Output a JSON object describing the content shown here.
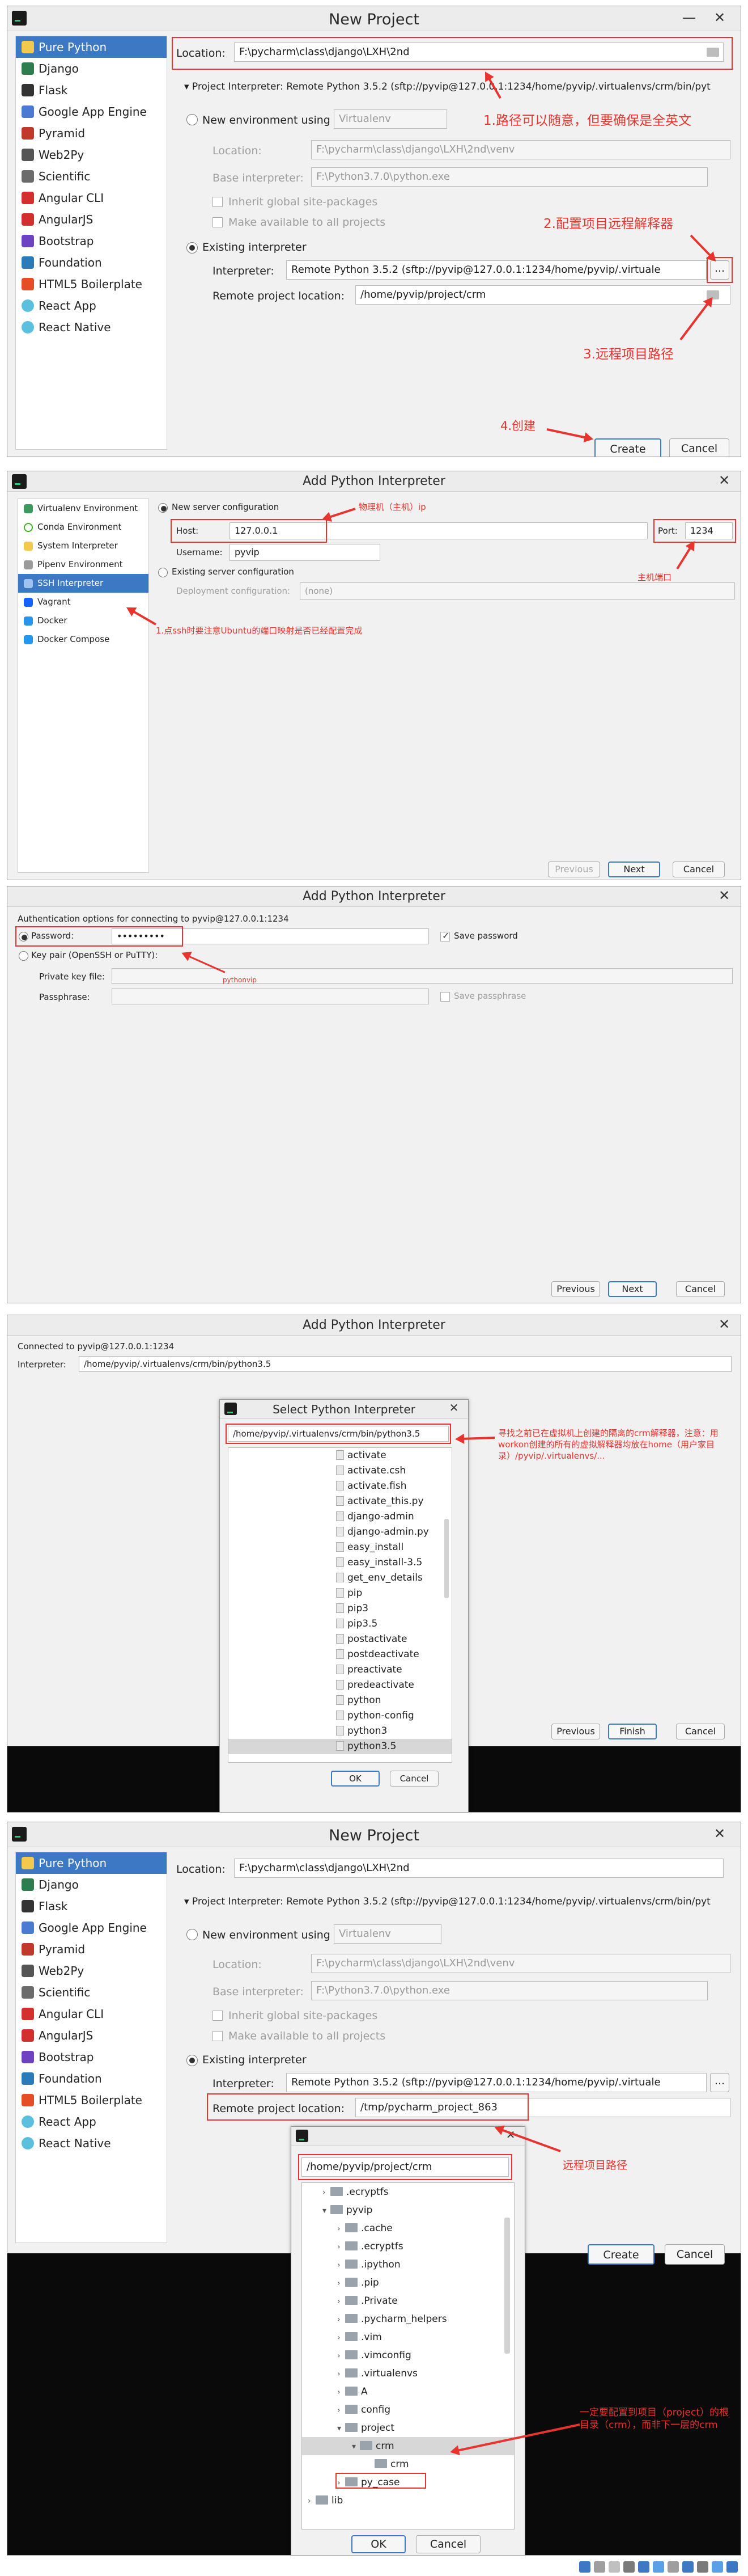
{
  "sidebar": [
    "Pure Python",
    "Django",
    "Flask",
    "Google App Engine",
    "Pyramid",
    "Web2Py",
    "Scientific",
    "Angular CLI",
    "AngularJS",
    "Bootstrap",
    "Foundation",
    "HTML5 Boilerplate",
    "React App",
    "React Native"
  ],
  "p1": {
    "title": "New Project",
    "location_label": "Location:",
    "location_value": "F:\\pycharm\\class\\django\\LXH\\2nd",
    "interp_header": "▾  Project Interpreter: Remote Python 3.5.2 (sftp://pyvip@127.0.0.1:1234/home/pyvip/.virtualenvs/crm/bin/pyt",
    "new_env": "New environment using",
    "virtualenv": "Virtualenv",
    "venv_location_label": "Location:",
    "venv_location": "F:\\pycharm\\class\\django\\LXH\\2nd\\venv",
    "base_interp_label": "Base interpreter:",
    "base_interp": "F:\\Python3.7.0\\python.exe",
    "inherit": "Inherit global site-packages",
    "make_available": "Make available to all projects",
    "existing": "Existing interpreter",
    "interp_label": "Interpreter:",
    "interp_value": "Remote Python 3.5.2 (sftp://pyvip@127.0.0.1:1234/home/pyvip/.virtuale",
    "more": "...",
    "remote_label": "Remote project location:",
    "remote_value": "/home/pyvip/project/crm",
    "note1": "1.路径可以随意，但要确保是全英文",
    "note2": "2.配置项目远程解释器",
    "note3": "3.远程项目路径",
    "note4": "4.创建",
    "create": "Create",
    "cancel": "Cancel"
  },
  "p2": {
    "title": "Add Python Interpreter",
    "types": [
      "Virtualenv Environment",
      "Conda Environment",
      "System Interpreter",
      "Pipenv Environment",
      "SSH Interpreter",
      "Vagrant",
      "Docker",
      "Docker Compose"
    ],
    "new_server": "New server configuration",
    "host_label": "Host:",
    "host_value": "127.0.0.1",
    "port_label": "Port:",
    "port_value": "1234",
    "user_label": "Username:",
    "user_value": "pyvip",
    "existing_config": "Existing server configuration",
    "deploy_label": "Deployment configuration:",
    "deploy_value": "(none)",
    "note_host": "物理机（主机）ip",
    "note_port": "主机端口",
    "note_ssh": "1.点ssh时要注意Ubuntu的端口映射是否已经配置完成",
    "previous": "Previous",
    "next": "Next",
    "cancel": "Cancel"
  },
  "p3": {
    "title": "Add Python Interpreter",
    "auth_label": "Authentication options for connecting to pyvip@127.0.0.1:1234",
    "password_label": "Password:",
    "password_value": "•••••••••",
    "save_password": "Save password",
    "key_pair": "Key pair (OpenSSH or PuTTY):",
    "private_key": "Private key file:",
    "passphrase": "Passphrase:",
    "save_passphrase": "Save passphrase",
    "note": "pythonvip",
    "previous": "Previous",
    "next": "Next",
    "cancel": "Cancel"
  },
  "p4": {
    "title": "Add Python Interpreter",
    "connected": "Connected to pyvip@127.0.0.1:1234",
    "interp_label": "Interpreter:",
    "interp_value": "/home/pyvip/.virtualenvs/crm/bin/python3.5",
    "previous": "Previous",
    "finish": "Finish",
    "cancel": "Cancel",
    "sub_title": "Select Python Interpreter",
    "sub_path": "/home/pyvip/.virtualenvs/crm/bin/python3.5",
    "files": [
      "activate",
      "activate.csh",
      "activate.fish",
      "activate_this.py",
      "django-admin",
      "django-admin.py",
      "easy_install",
      "easy_install-3.5",
      "get_env_details",
      "pip",
      "pip3",
      "pip3.5",
      "postactivate",
      "postdeactivate",
      "preactivate",
      "predeactivate",
      "python",
      "python-config",
      "python3",
      "python3.5"
    ],
    "ok": "OK",
    "note": "寻找之前已在虚拟机上创建的隔离的crm解释器，注意：用workon创建的所有的虚拟解释器均放在home（用户家目录）/pyvip/.virtualenvs/..."
  },
  "p5": {
    "remote_value": "/tmp/pycharm_project_863",
    "sub_path": "/home/pyvip/project/crm",
    "folders": [
      {
        "name": ".ecryptfs",
        "depth": 1,
        "open": false
      },
      {
        "name": "pyvip",
        "depth": 1,
        "open": true
      },
      {
        "name": ".cache",
        "depth": 2,
        "open": false
      },
      {
        "name": ".ecryptfs",
        "depth": 2,
        "open": false
      },
      {
        "name": ".ipython",
        "depth": 2,
        "open": false
      },
      {
        "name": ".pip",
        "depth": 2,
        "open": false
      },
      {
        "name": ".Private",
        "depth": 2,
        "open": false
      },
      {
        "name": ".pycharm_helpers",
        "depth": 2,
        "open": false
      },
      {
        "name": ".vim",
        "depth": 2,
        "open": false
      },
      {
        "name": ".vimconfig",
        "depth": 2,
        "open": false
      },
      {
        "name": ".virtualenvs",
        "depth": 2,
        "open": false
      },
      {
        "name": "A",
        "depth": 2,
        "open": false
      },
      {
        "name": "config",
        "depth": 2,
        "open": false
      },
      {
        "name": "project",
        "depth": 2,
        "open": true
      },
      {
        "name": "crm",
        "depth": 3,
        "open": true,
        "selected": true
      },
      {
        "name": "crm",
        "depth": 4,
        "open": false,
        "leaf": true
      },
      {
        "name": "py_case",
        "depth": 2,
        "open": false
      },
      {
        "name": "lib",
        "depth": 0,
        "open": false
      }
    ],
    "ok": "OK",
    "cancel": "Cancel",
    "note1": "远程项目路径",
    "note2": "一定要配置到项目（project）的根目录（crm），而非下一层的crm"
  }
}
